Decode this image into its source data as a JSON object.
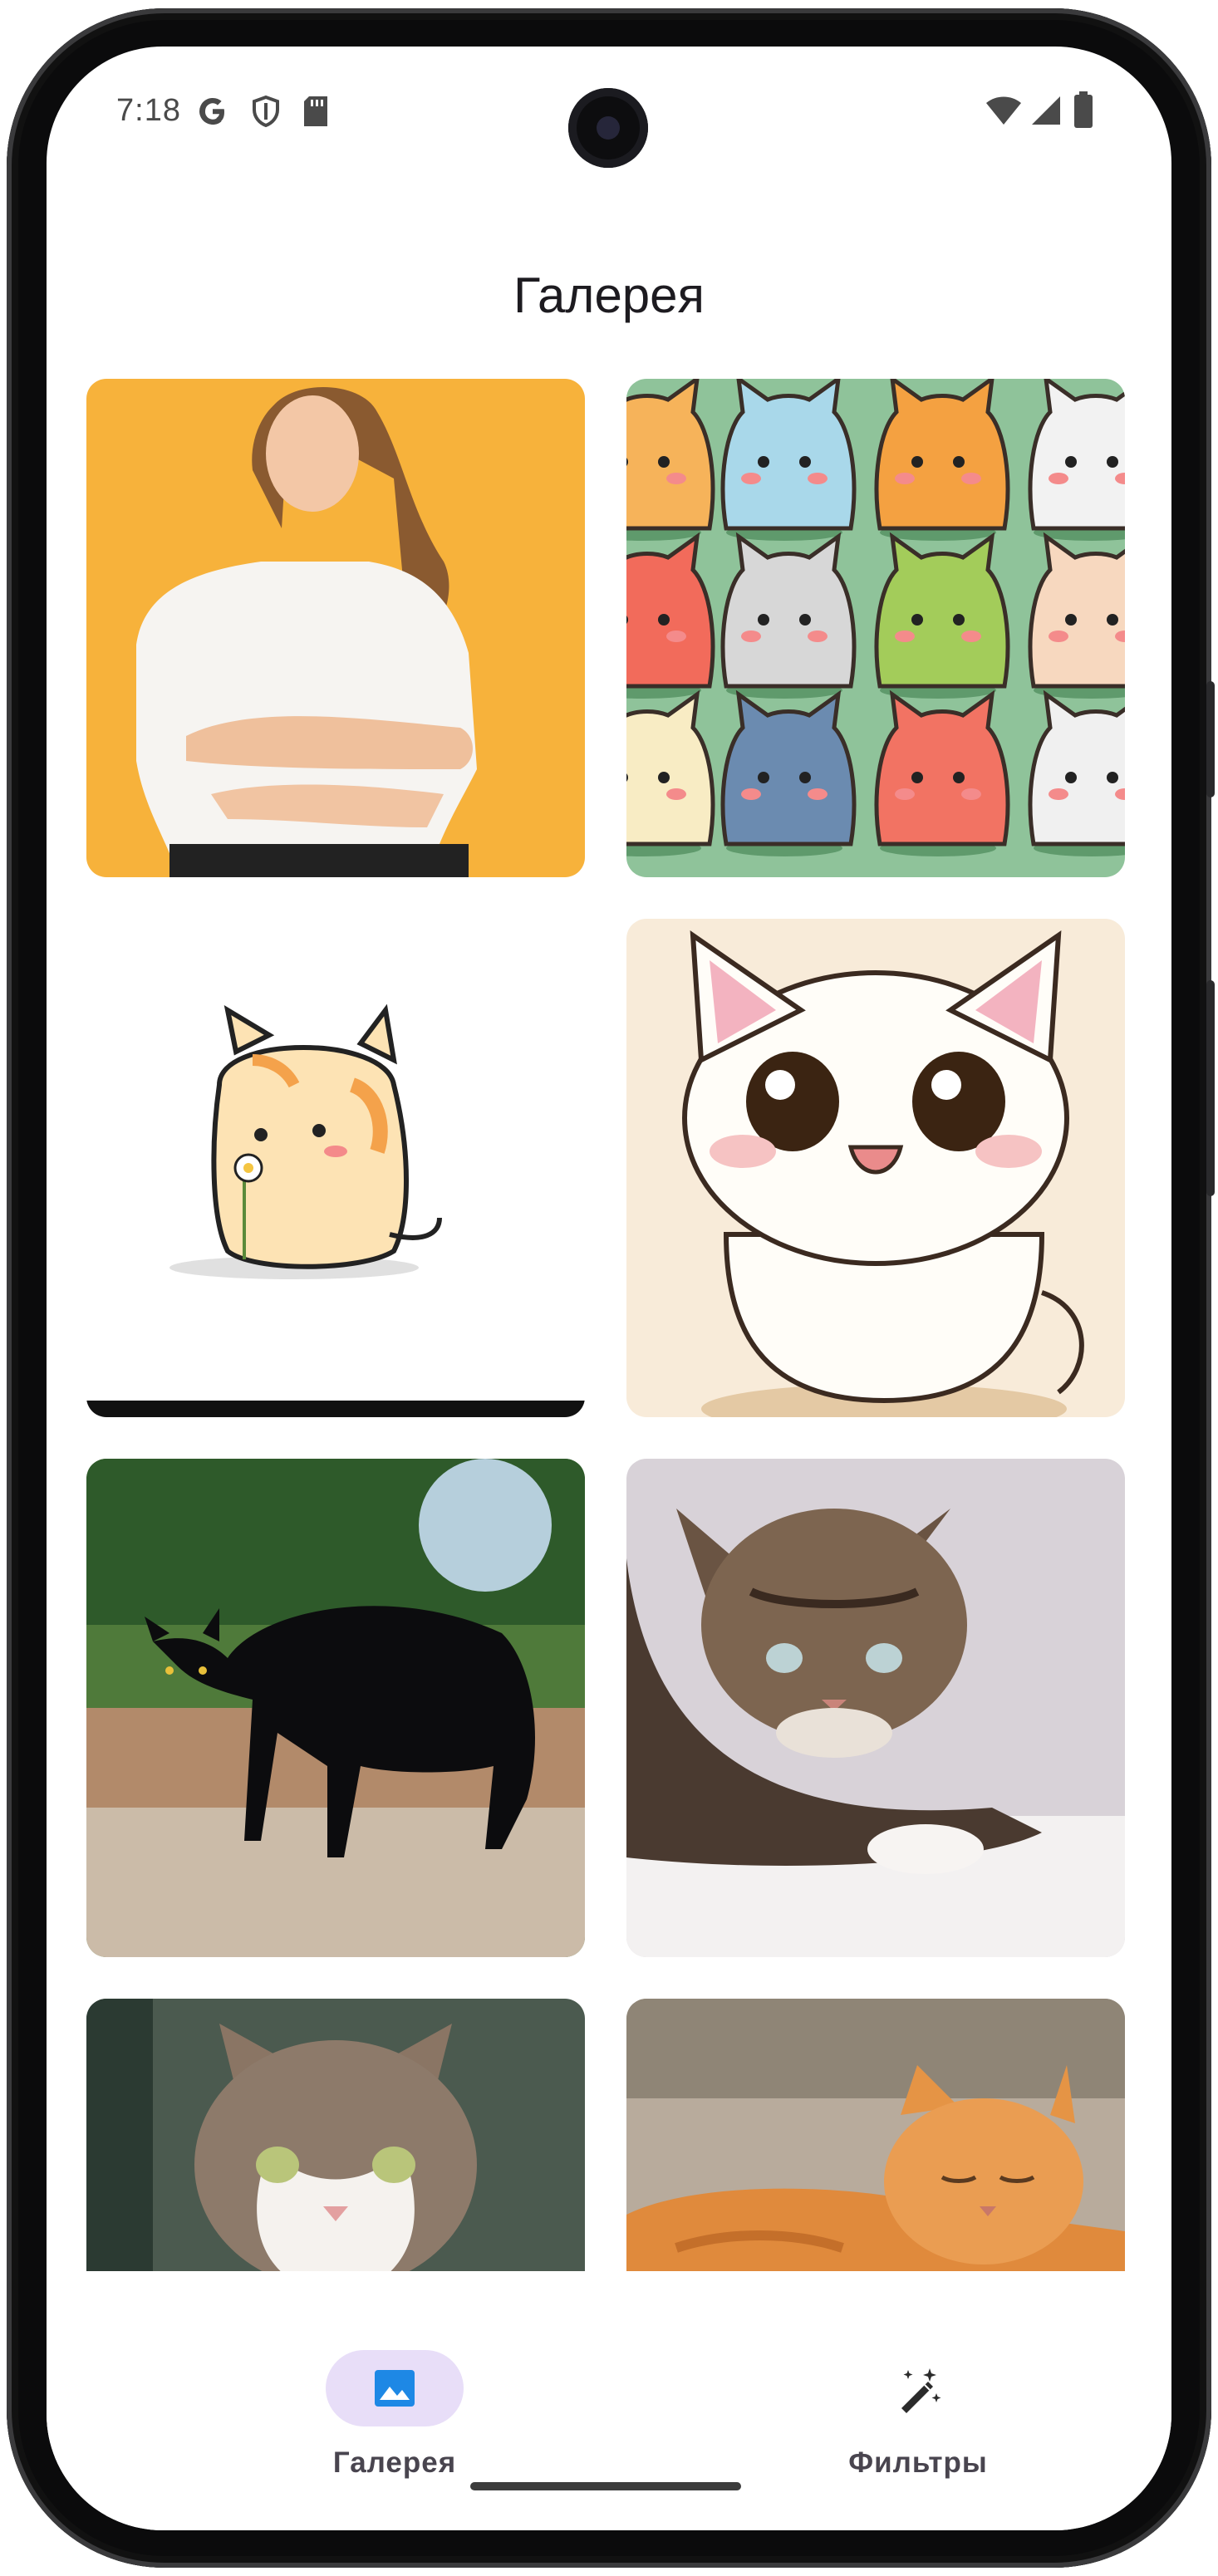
{
  "status_bar": {
    "time": "7:18",
    "left_icons": [
      "google-g-icon",
      "shield-icon",
      "sd-card-icon"
    ],
    "right_icons": [
      "wifi-icon",
      "signal-icon",
      "battery-icon"
    ]
  },
  "app_bar": {
    "title": "Галерея"
  },
  "gallery": {
    "images": [
      {
        "name": "woman-photo",
        "description_kind": "photo"
      },
      {
        "name": "cartoon-cats-grid",
        "description_kind": "illustration"
      },
      {
        "name": "cartoon-orange-cat",
        "description_kind": "illustration"
      },
      {
        "name": "cartoon-white-kitten",
        "description_kind": "illustration"
      },
      {
        "name": "black-cat-photo",
        "description_kind": "photo"
      },
      {
        "name": "tabby-kitten-photo",
        "description_kind": "photo"
      },
      {
        "name": "tabby-white-cat-photo",
        "description_kind": "photo"
      },
      {
        "name": "orange-cat-photo",
        "description_kind": "photo"
      }
    ]
  },
  "bottom_nav": {
    "items": [
      {
        "label": "Галерея",
        "icon": "image-icon",
        "active": true
      },
      {
        "label": "Фильтры",
        "icon": "magic-wand-icon",
        "active": false
      }
    ]
  },
  "colors": {
    "nav_active_pill": "#e8def8",
    "nav_active_icon": "#1e88e5",
    "label": "#49454f"
  }
}
